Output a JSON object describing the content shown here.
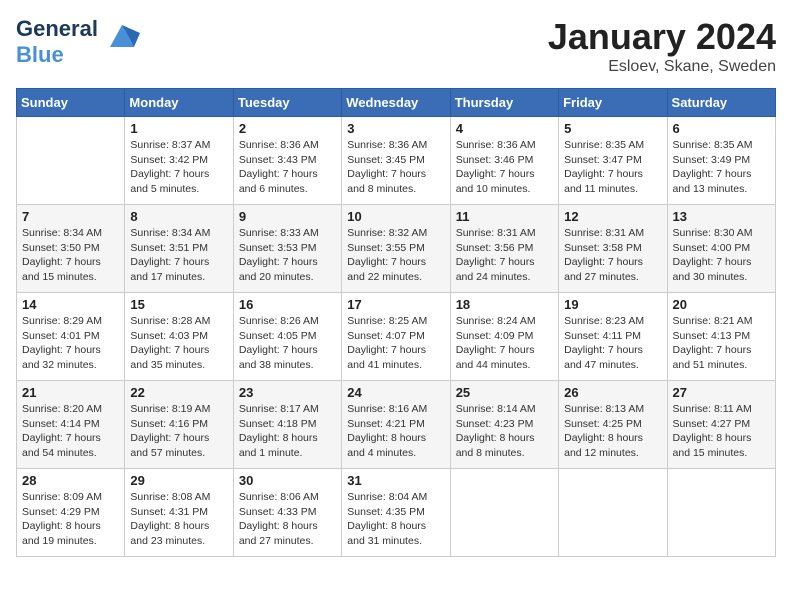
{
  "header": {
    "logo_line1": "General",
    "logo_line2": "Blue",
    "month": "January 2024",
    "location": "Esloev, Skane, Sweden"
  },
  "days_of_week": [
    "Sunday",
    "Monday",
    "Tuesday",
    "Wednesday",
    "Thursday",
    "Friday",
    "Saturday"
  ],
  "weeks": [
    [
      {
        "day": "",
        "text": ""
      },
      {
        "day": "1",
        "text": "Sunrise: 8:37 AM\nSunset: 3:42 PM\nDaylight: 7 hours\nand 5 minutes."
      },
      {
        "day": "2",
        "text": "Sunrise: 8:36 AM\nSunset: 3:43 PM\nDaylight: 7 hours\nand 6 minutes."
      },
      {
        "day": "3",
        "text": "Sunrise: 8:36 AM\nSunset: 3:45 PM\nDaylight: 7 hours\nand 8 minutes."
      },
      {
        "day": "4",
        "text": "Sunrise: 8:36 AM\nSunset: 3:46 PM\nDaylight: 7 hours\nand 10 minutes."
      },
      {
        "day": "5",
        "text": "Sunrise: 8:35 AM\nSunset: 3:47 PM\nDaylight: 7 hours\nand 11 minutes."
      },
      {
        "day": "6",
        "text": "Sunrise: 8:35 AM\nSunset: 3:49 PM\nDaylight: 7 hours\nand 13 minutes."
      }
    ],
    [
      {
        "day": "7",
        "text": "Sunrise: 8:34 AM\nSunset: 3:50 PM\nDaylight: 7 hours\nand 15 minutes."
      },
      {
        "day": "8",
        "text": "Sunrise: 8:34 AM\nSunset: 3:51 PM\nDaylight: 7 hours\nand 17 minutes."
      },
      {
        "day": "9",
        "text": "Sunrise: 8:33 AM\nSunset: 3:53 PM\nDaylight: 7 hours\nand 20 minutes."
      },
      {
        "day": "10",
        "text": "Sunrise: 8:32 AM\nSunset: 3:55 PM\nDaylight: 7 hours\nand 22 minutes."
      },
      {
        "day": "11",
        "text": "Sunrise: 8:31 AM\nSunset: 3:56 PM\nDaylight: 7 hours\nand 24 minutes."
      },
      {
        "day": "12",
        "text": "Sunrise: 8:31 AM\nSunset: 3:58 PM\nDaylight: 7 hours\nand 27 minutes."
      },
      {
        "day": "13",
        "text": "Sunrise: 8:30 AM\nSunset: 4:00 PM\nDaylight: 7 hours\nand 30 minutes."
      }
    ],
    [
      {
        "day": "14",
        "text": "Sunrise: 8:29 AM\nSunset: 4:01 PM\nDaylight: 7 hours\nand 32 minutes."
      },
      {
        "day": "15",
        "text": "Sunrise: 8:28 AM\nSunset: 4:03 PM\nDaylight: 7 hours\nand 35 minutes."
      },
      {
        "day": "16",
        "text": "Sunrise: 8:26 AM\nSunset: 4:05 PM\nDaylight: 7 hours\nand 38 minutes."
      },
      {
        "day": "17",
        "text": "Sunrise: 8:25 AM\nSunset: 4:07 PM\nDaylight: 7 hours\nand 41 minutes."
      },
      {
        "day": "18",
        "text": "Sunrise: 8:24 AM\nSunset: 4:09 PM\nDaylight: 7 hours\nand 44 minutes."
      },
      {
        "day": "19",
        "text": "Sunrise: 8:23 AM\nSunset: 4:11 PM\nDaylight: 7 hours\nand 47 minutes."
      },
      {
        "day": "20",
        "text": "Sunrise: 8:21 AM\nSunset: 4:13 PM\nDaylight: 7 hours\nand 51 minutes."
      }
    ],
    [
      {
        "day": "21",
        "text": "Sunrise: 8:20 AM\nSunset: 4:14 PM\nDaylight: 7 hours\nand 54 minutes."
      },
      {
        "day": "22",
        "text": "Sunrise: 8:19 AM\nSunset: 4:16 PM\nDaylight: 7 hours\nand 57 minutes."
      },
      {
        "day": "23",
        "text": "Sunrise: 8:17 AM\nSunset: 4:18 PM\nDaylight: 8 hours\nand 1 minute."
      },
      {
        "day": "24",
        "text": "Sunrise: 8:16 AM\nSunset: 4:21 PM\nDaylight: 8 hours\nand 4 minutes."
      },
      {
        "day": "25",
        "text": "Sunrise: 8:14 AM\nSunset: 4:23 PM\nDaylight: 8 hours\nand 8 minutes."
      },
      {
        "day": "26",
        "text": "Sunrise: 8:13 AM\nSunset: 4:25 PM\nDaylight: 8 hours\nand 12 minutes."
      },
      {
        "day": "27",
        "text": "Sunrise: 8:11 AM\nSunset: 4:27 PM\nDaylight: 8 hours\nand 15 minutes."
      }
    ],
    [
      {
        "day": "28",
        "text": "Sunrise: 8:09 AM\nSunset: 4:29 PM\nDaylight: 8 hours\nand 19 minutes."
      },
      {
        "day": "29",
        "text": "Sunrise: 8:08 AM\nSunset: 4:31 PM\nDaylight: 8 hours\nand 23 minutes."
      },
      {
        "day": "30",
        "text": "Sunrise: 8:06 AM\nSunset: 4:33 PM\nDaylight: 8 hours\nand 27 minutes."
      },
      {
        "day": "31",
        "text": "Sunrise: 8:04 AM\nSunset: 4:35 PM\nDaylight: 8 hours\nand 31 minutes."
      },
      {
        "day": "",
        "text": ""
      },
      {
        "day": "",
        "text": ""
      },
      {
        "day": "",
        "text": ""
      }
    ]
  ]
}
